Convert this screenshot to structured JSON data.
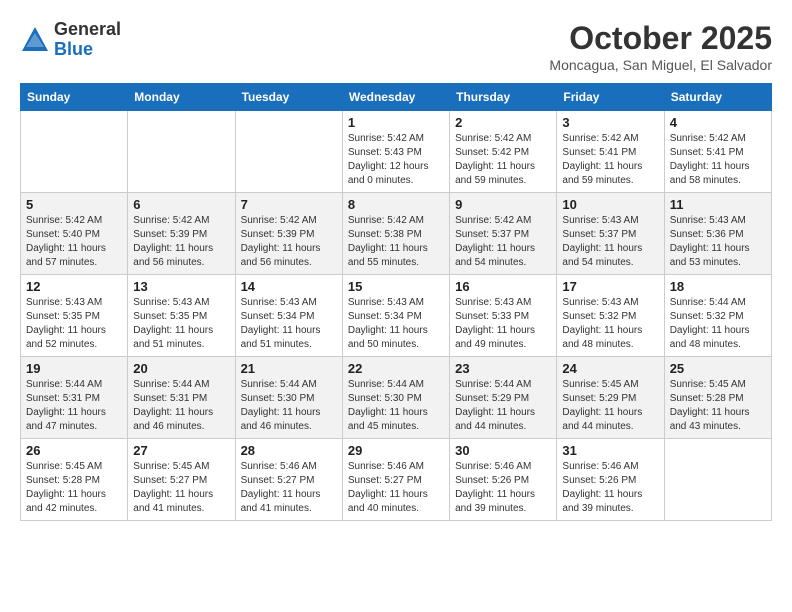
{
  "logo": {
    "general": "General",
    "blue": "Blue"
  },
  "title": "October 2025",
  "location": "Moncagua, San Miguel, El Salvador",
  "days_of_week": [
    "Sunday",
    "Monday",
    "Tuesday",
    "Wednesday",
    "Thursday",
    "Friday",
    "Saturday"
  ],
  "weeks": [
    [
      {
        "day": "",
        "info": ""
      },
      {
        "day": "",
        "info": ""
      },
      {
        "day": "",
        "info": ""
      },
      {
        "day": "1",
        "info": "Sunrise: 5:42 AM\nSunset: 5:43 PM\nDaylight: 12 hours\nand 0 minutes."
      },
      {
        "day": "2",
        "info": "Sunrise: 5:42 AM\nSunset: 5:42 PM\nDaylight: 11 hours\nand 59 minutes."
      },
      {
        "day": "3",
        "info": "Sunrise: 5:42 AM\nSunset: 5:41 PM\nDaylight: 11 hours\nand 59 minutes."
      },
      {
        "day": "4",
        "info": "Sunrise: 5:42 AM\nSunset: 5:41 PM\nDaylight: 11 hours\nand 58 minutes."
      }
    ],
    [
      {
        "day": "5",
        "info": "Sunrise: 5:42 AM\nSunset: 5:40 PM\nDaylight: 11 hours\nand 57 minutes."
      },
      {
        "day": "6",
        "info": "Sunrise: 5:42 AM\nSunset: 5:39 PM\nDaylight: 11 hours\nand 56 minutes."
      },
      {
        "day": "7",
        "info": "Sunrise: 5:42 AM\nSunset: 5:39 PM\nDaylight: 11 hours\nand 56 minutes."
      },
      {
        "day": "8",
        "info": "Sunrise: 5:42 AM\nSunset: 5:38 PM\nDaylight: 11 hours\nand 55 minutes."
      },
      {
        "day": "9",
        "info": "Sunrise: 5:42 AM\nSunset: 5:37 PM\nDaylight: 11 hours\nand 54 minutes."
      },
      {
        "day": "10",
        "info": "Sunrise: 5:43 AM\nSunset: 5:37 PM\nDaylight: 11 hours\nand 54 minutes."
      },
      {
        "day": "11",
        "info": "Sunrise: 5:43 AM\nSunset: 5:36 PM\nDaylight: 11 hours\nand 53 minutes."
      }
    ],
    [
      {
        "day": "12",
        "info": "Sunrise: 5:43 AM\nSunset: 5:35 PM\nDaylight: 11 hours\nand 52 minutes."
      },
      {
        "day": "13",
        "info": "Sunrise: 5:43 AM\nSunset: 5:35 PM\nDaylight: 11 hours\nand 51 minutes."
      },
      {
        "day": "14",
        "info": "Sunrise: 5:43 AM\nSunset: 5:34 PM\nDaylight: 11 hours\nand 51 minutes."
      },
      {
        "day": "15",
        "info": "Sunrise: 5:43 AM\nSunset: 5:34 PM\nDaylight: 11 hours\nand 50 minutes."
      },
      {
        "day": "16",
        "info": "Sunrise: 5:43 AM\nSunset: 5:33 PM\nDaylight: 11 hours\nand 49 minutes."
      },
      {
        "day": "17",
        "info": "Sunrise: 5:43 AM\nSunset: 5:32 PM\nDaylight: 11 hours\nand 48 minutes."
      },
      {
        "day": "18",
        "info": "Sunrise: 5:44 AM\nSunset: 5:32 PM\nDaylight: 11 hours\nand 48 minutes."
      }
    ],
    [
      {
        "day": "19",
        "info": "Sunrise: 5:44 AM\nSunset: 5:31 PM\nDaylight: 11 hours\nand 47 minutes."
      },
      {
        "day": "20",
        "info": "Sunrise: 5:44 AM\nSunset: 5:31 PM\nDaylight: 11 hours\nand 46 minutes."
      },
      {
        "day": "21",
        "info": "Sunrise: 5:44 AM\nSunset: 5:30 PM\nDaylight: 11 hours\nand 46 minutes."
      },
      {
        "day": "22",
        "info": "Sunrise: 5:44 AM\nSunset: 5:30 PM\nDaylight: 11 hours\nand 45 minutes."
      },
      {
        "day": "23",
        "info": "Sunrise: 5:44 AM\nSunset: 5:29 PM\nDaylight: 11 hours\nand 44 minutes."
      },
      {
        "day": "24",
        "info": "Sunrise: 5:45 AM\nSunset: 5:29 PM\nDaylight: 11 hours\nand 44 minutes."
      },
      {
        "day": "25",
        "info": "Sunrise: 5:45 AM\nSunset: 5:28 PM\nDaylight: 11 hours\nand 43 minutes."
      }
    ],
    [
      {
        "day": "26",
        "info": "Sunrise: 5:45 AM\nSunset: 5:28 PM\nDaylight: 11 hours\nand 42 minutes."
      },
      {
        "day": "27",
        "info": "Sunrise: 5:45 AM\nSunset: 5:27 PM\nDaylight: 11 hours\nand 41 minutes."
      },
      {
        "day": "28",
        "info": "Sunrise: 5:46 AM\nSunset: 5:27 PM\nDaylight: 11 hours\nand 41 minutes."
      },
      {
        "day": "29",
        "info": "Sunrise: 5:46 AM\nSunset: 5:27 PM\nDaylight: 11 hours\nand 40 minutes."
      },
      {
        "day": "30",
        "info": "Sunrise: 5:46 AM\nSunset: 5:26 PM\nDaylight: 11 hours\nand 39 minutes."
      },
      {
        "day": "31",
        "info": "Sunrise: 5:46 AM\nSunset: 5:26 PM\nDaylight: 11 hours\nand 39 minutes."
      },
      {
        "day": "",
        "info": ""
      }
    ]
  ]
}
